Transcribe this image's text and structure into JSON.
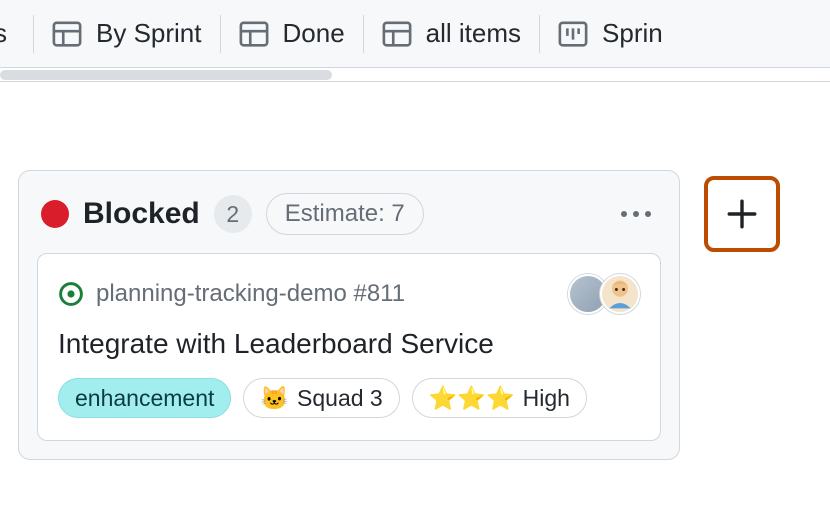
{
  "tabs": {
    "partial_left": "s",
    "items": [
      {
        "label": "By Sprint",
        "icon": "table"
      },
      {
        "label": "Done",
        "icon": "table"
      },
      {
        "label": "all items",
        "icon": "table"
      },
      {
        "label": "Sprin",
        "icon": "board"
      }
    ]
  },
  "column": {
    "status_color": "#da1d2a",
    "title": "Blocked",
    "count": "2",
    "estimate_label": "Estimate: 7"
  },
  "card": {
    "repo_ref": "planning-tracking-demo #811",
    "title": "Integrate with Leaderboard Service",
    "labels": {
      "enhancement": "enhancement",
      "squad": {
        "emoji": "🐱",
        "text": "Squad 3"
      },
      "priority": {
        "emoji": "⭐⭐⭐",
        "text": "High"
      }
    },
    "assignees": [
      "user-1",
      "user-2"
    ]
  }
}
